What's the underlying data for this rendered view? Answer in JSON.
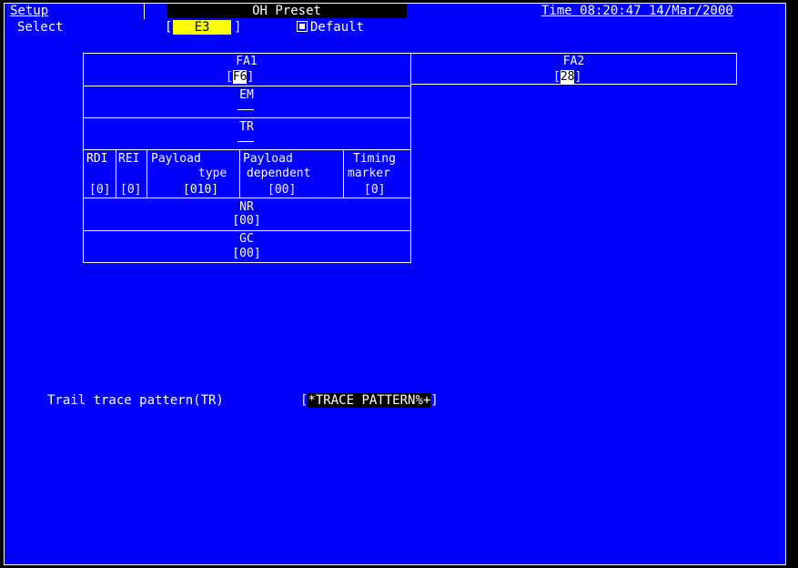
{
  "header": {
    "menu": "Setup",
    "select_label": "Select",
    "title": "OH Preset",
    "time": "Time 08:20:47 14/Mar/2000",
    "select_open": "[",
    "select_value": "E3",
    "select_close": "]",
    "default_label": "Default"
  },
  "table": {
    "fa1": {
      "label": "FA1",
      "open": "[",
      "value": "F6",
      "close": "]"
    },
    "fa2": {
      "label": "FA2",
      "open": "[",
      "value": "28",
      "close": "]"
    },
    "em": {
      "label": "EM"
    },
    "tr": {
      "label": "TR"
    },
    "rdi": {
      "label": "RDI",
      "value": "[0]"
    },
    "rei": {
      "label": "REI",
      "value": "[0]"
    },
    "payload_type": {
      "label1": "Payload",
      "label2": "type",
      "value": "[010]"
    },
    "payload_dep": {
      "label1": "Payload",
      "label2": "dependent",
      "value": "[00]"
    },
    "timing": {
      "label1": "Timing",
      "label2": "marker",
      "value": "[0]"
    },
    "nr": {
      "label": "NR",
      "value": "[00]"
    },
    "gc": {
      "label": "GC",
      "value": "[00]"
    }
  },
  "trace": {
    "label": "Trail trace pattern(TR)",
    "open": "[",
    "value": "*TRACE PATTERN%+",
    "close": "]"
  },
  "colors": {
    "background": "#0000ff",
    "highlight": "#ffff00",
    "text": "#ffffff"
  }
}
